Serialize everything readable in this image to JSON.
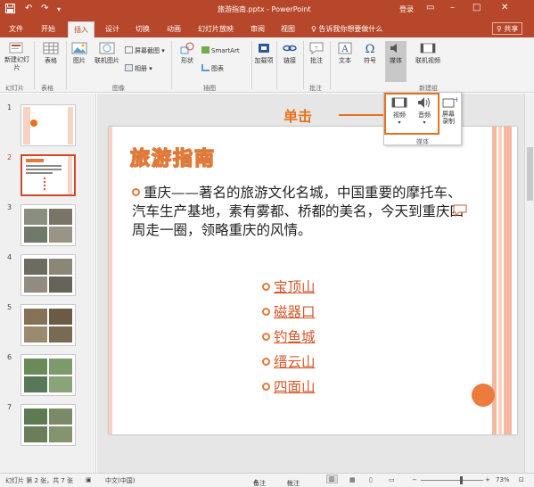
{
  "titlebar": {
    "title": "旅游指南.pptx - PowerPoint",
    "login": "登录",
    "save_icon": "save-icon",
    "undo_icon": "undo-icon",
    "redo_icon": "redo-icon"
  },
  "tabs": [
    {
      "label": "文件"
    },
    {
      "label": "开始"
    },
    {
      "label": "插入",
      "active": true
    },
    {
      "label": "设计"
    },
    {
      "label": "切换"
    },
    {
      "label": "动画"
    },
    {
      "label": "幻灯片放映"
    },
    {
      "label": "审阅"
    },
    {
      "label": "视图"
    }
  ],
  "tell_me": "告诉我你想要做什么",
  "share": "共享",
  "ribbon": {
    "new_slide": "新建幻灯片",
    "table": "表格",
    "picture": "图片",
    "online_picture": "联机图片",
    "screenshot": "屏幕截图",
    "album": "相册",
    "shapes": "形状",
    "smartart": "SmartArt",
    "chart": "图表",
    "addins": "加载项",
    "link": "链接",
    "comment": "批注",
    "text": "文本",
    "symbol": "符号",
    "media": "媒体",
    "online_video": "联机视频",
    "groups": {
      "slides": "幻灯片",
      "tables": "表格",
      "images": "图像",
      "illustrations": "插图",
      "comments": "批注",
      "new_group": "新建组"
    }
  },
  "media_popup": {
    "video": "视频",
    "audio": "音频",
    "screen_record": "屏幕录制",
    "group_label": "媒体"
  },
  "callout": "单击",
  "slides": [
    {
      "number": "1"
    },
    {
      "number": "2",
      "selected": true
    },
    {
      "number": "3"
    },
    {
      "number": "4"
    },
    {
      "number": "5"
    },
    {
      "number": "6"
    },
    {
      "number": "7"
    }
  ],
  "slide": {
    "title": "旅游指南",
    "body": "重庆——著名的旅游文化名城，中国重要的摩托车、汽车生产基地，素有雾都、桥都的美名，今天到重庆四周走一圈，领略重庆的风情。",
    "places": [
      "宝顶山",
      "磁器口",
      "钓鱼城",
      "缙云山",
      "四面山"
    ]
  },
  "statusbar": {
    "slide_info": "幻灯片 第 2 张，共 7 张",
    "language": "中文(中国)",
    "notes": "备注",
    "comments": "批注",
    "zoom": "73%"
  },
  "colors": {
    "accent": "#b7472a",
    "highlight": "#e8731e",
    "title_orange": "#e07a3a",
    "place_link": "#d2582b"
  }
}
